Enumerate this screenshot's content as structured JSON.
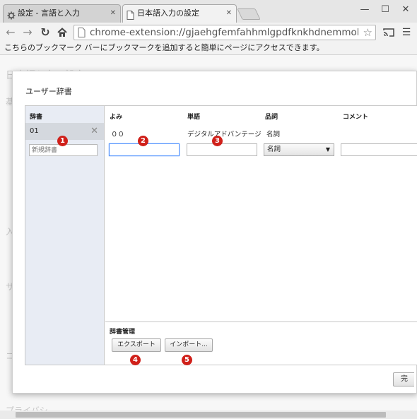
{
  "browser": {
    "tabs": [
      {
        "title": "設定 - 言語と入力",
        "icon": "gear-icon",
        "active": false
      },
      {
        "title": "日本語入力の設定",
        "icon": "page-icon",
        "active": true
      }
    ],
    "url": "chrome-extension://gjaehgfemfahhmlgpdfknkhdnemmolop",
    "bookmark_bar_text": "こちらのブックマーク バーにブックマークを追加すると簡単にページにアクセスできます。"
  },
  "background_page": {
    "title": "日本語入力の設定",
    "fragments": [
      "基",
      "入",
      "サ",
      "コ",
      "プライバシ"
    ]
  },
  "dialog": {
    "title": "ユーザー辞書",
    "dictionary_header": "辞書",
    "dictionaries": [
      {
        "name": "01"
      }
    ],
    "new_dictionary_placeholder": "新規辞書",
    "columns": {
      "reading": "よみ",
      "word": "単語",
      "pos": "品詞",
      "comment": "コメント"
    },
    "entries": [
      {
        "reading": "００",
        "word": "デジタルアドバンテージ",
        "pos": "名詞",
        "comment": ""
      }
    ],
    "new_entry": {
      "reading": "",
      "word": "",
      "pos": "名詞",
      "comment": ""
    },
    "management_header": "辞書管理",
    "export_label": "エクスポート",
    "import_label": "インポート...",
    "ok_label": "完"
  },
  "callouts": [
    "1",
    "2",
    "3",
    "4",
    "5"
  ],
  "colors": {
    "callout": "#d0201a",
    "dict_panel": "#e8ecf4",
    "focus": "#4d90fe"
  }
}
